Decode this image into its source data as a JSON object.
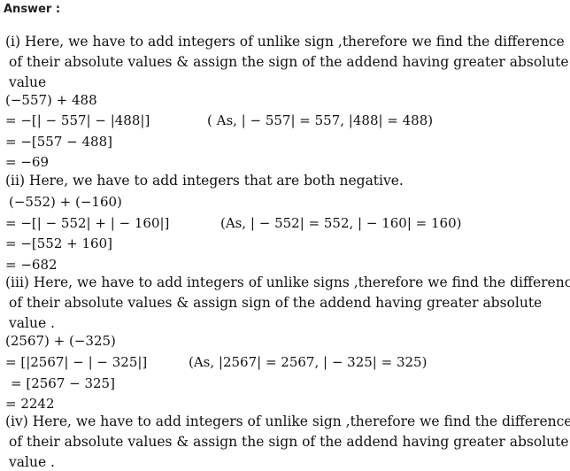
{
  "answer_label": "Answer :",
  "part1": {
    "text_l1": "(i) Here, we have to add integers of unlike sign ,therefore we find the difference",
    "text_l2": "of their absolute values & assign the sign of the addend having greater absolute",
    "text_l3": "value",
    "eq1": "(−557) + 488",
    "eq2": "= −[| − 557| − |488|]",
    "note": "( As, | − 557| = 557, |488| = 488)",
    "eq3": "= −[557 − 488]",
    "eq4": "= −69"
  },
  "part2": {
    "text_l1": "(ii) Here, we have to add integers that are both negative.",
    "eq1": "(−552) + (−160)",
    "eq2": "= −[| − 552| + | − 160|]",
    "note": "(As, | − 552| = 552, | − 160| = 160)",
    "eq3": "= −[552 + 160]",
    "eq4": "= −682"
  },
  "part3": {
    "text_l1": "(iii) Here, we have to add integers of unlike signs ,therefore we find the difference",
    "text_l2": "of their absolute values & assign sign of the addend having greater absolute",
    "text_l3": "value .",
    "eq1": "(2567) + (−325)",
    "eq2": "= [|2567| − | − 325|]",
    "note": "(As, |2567| = 2567, | − 325| = 325)",
    "eq3": "= [2567 − 325]",
    "eq4": "= 2242"
  },
  "part4": {
    "text_l1": "(iv) Here, we have to add integers of unlike sign ,therefore we find the difference",
    "text_l2": "of their absolute values & assign the sign of the addend having greater absolute",
    "text_l3": "value ."
  }
}
